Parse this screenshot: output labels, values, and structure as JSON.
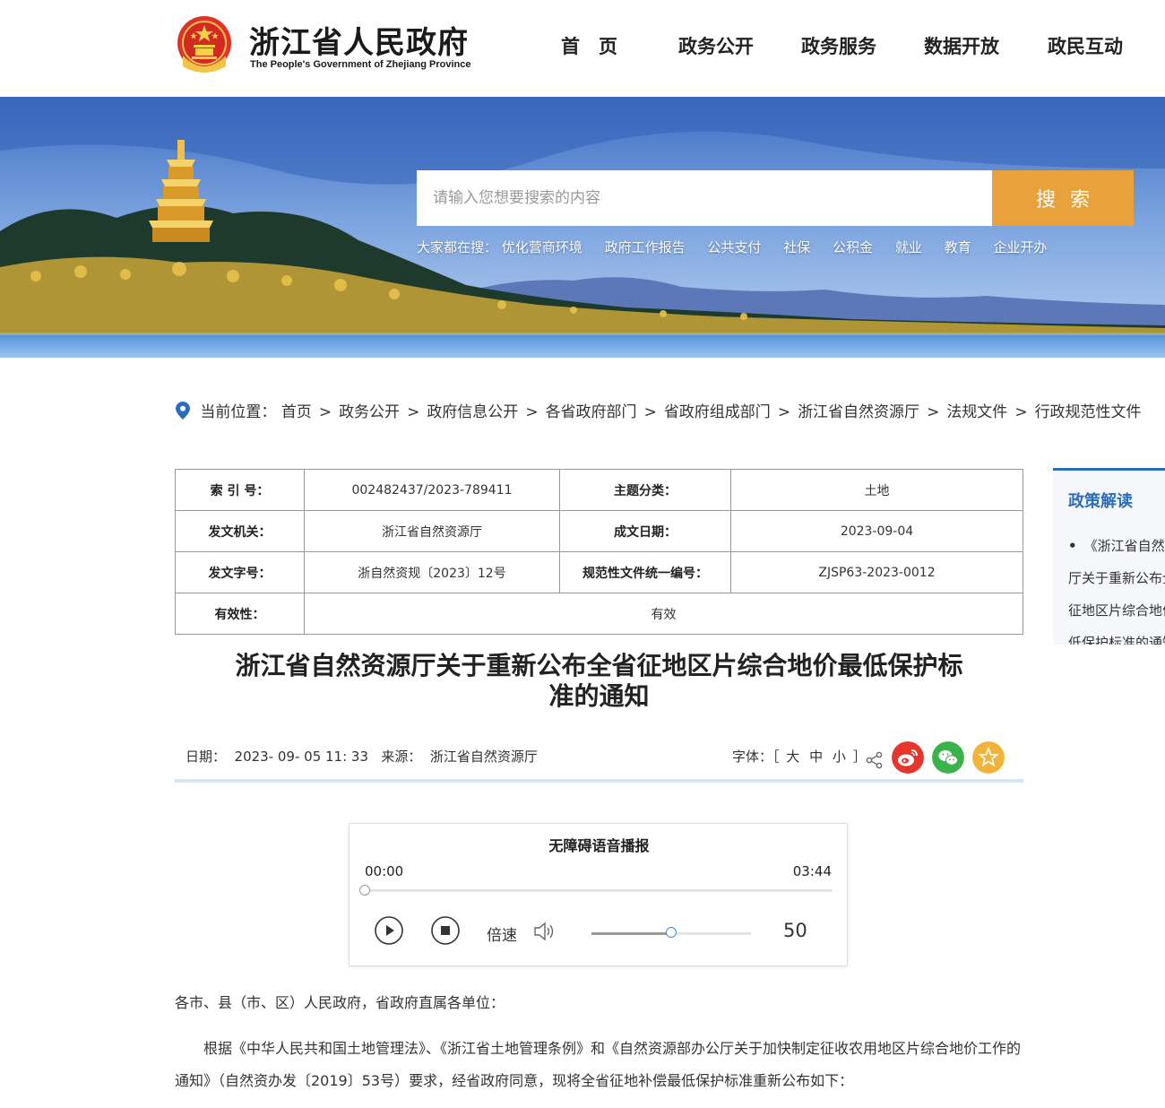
{
  "header": {
    "title": "浙江省人民政府",
    "subtitle": "The People's Government of Zhejiang Province",
    "nav": [
      "首　页",
      "政务公开",
      "政务服务",
      "数据开放",
      "政民互动"
    ]
  },
  "banner": {
    "search_placeholder": "请输入您想要搜索的内容",
    "search_button": "搜索",
    "hot_label": "大家都在搜：",
    "hot_terms": [
      "优化营商环境",
      "政府工作报告",
      "公共支付",
      "社保",
      "公积金",
      "就业",
      "教育",
      "企业开办"
    ]
  },
  "breadcrumb": {
    "label": "当前位置：",
    "items": [
      "首页",
      "政务公开",
      "政府信息公开",
      "各省政府部门",
      "省政府组成部门",
      "浙江省自然资源厅",
      "法规文件",
      "行政规范性文件"
    ]
  },
  "info_table": {
    "index_key": "索 引 号：",
    "index_val": "002482437/2023-789411",
    "topic_key": "主题分类：",
    "topic_val": "土地",
    "issuer_key": "发文机关：",
    "issuer_val": "浙江省自然资源厅",
    "date_key": "成文日期：",
    "date_val": "2023-09-04",
    "docno_key": "发文字号：",
    "docno_val": "浙自然资规〔2023〕12号",
    "code_key": "规范性文件统一编号：",
    "code_val": "ZJSP63-2023-0012",
    "valid_key": "有效性：",
    "valid_val": "有效"
  },
  "sidebar": {
    "title": "政策解读",
    "item": "《浙江省自然资源厅关于重新公布全省征地区片综合地价最低保护标准的通知（征求意见稿）》政策解读"
  },
  "article": {
    "title_line1": "浙江省自然资源厅关于重新公布全省征地区片综合地价最低保护标",
    "title_line2": "准的通知",
    "meta": "日期：  2023- 09- 05 11: 33   来源：  浙江省自然资源厅",
    "font_label": "字体：［",
    "font_large": "大",
    "font_medium": "中",
    "font_small": "小",
    "font_end": "］",
    "para1": "各市、县（市、区）人民政府，省政府直属各单位：",
    "para2": "　　根据《中华人民共和国土地管理法》、《浙江省土地管理条例》和《自然资源部办公厅关于加快制定征收农用地区片综合地价工作的通知》（自然资办发〔2019〕53号）要求，经省政府同意，现将全省征地补偿最低保护标准重新公布如下："
  },
  "player": {
    "title": "无障碍语音播报",
    "current_time": "00:00",
    "duration": "03:44",
    "progress": 0,
    "speed_label": "倍速",
    "volume": 50
  },
  "colors": {
    "accent_orange": "#e9a23b",
    "link_blue": "#2a6ebb",
    "weibo_red": "#e6352d",
    "wechat_green": "#3bb34a",
    "favorite_yellow": "#f0b43c"
  }
}
